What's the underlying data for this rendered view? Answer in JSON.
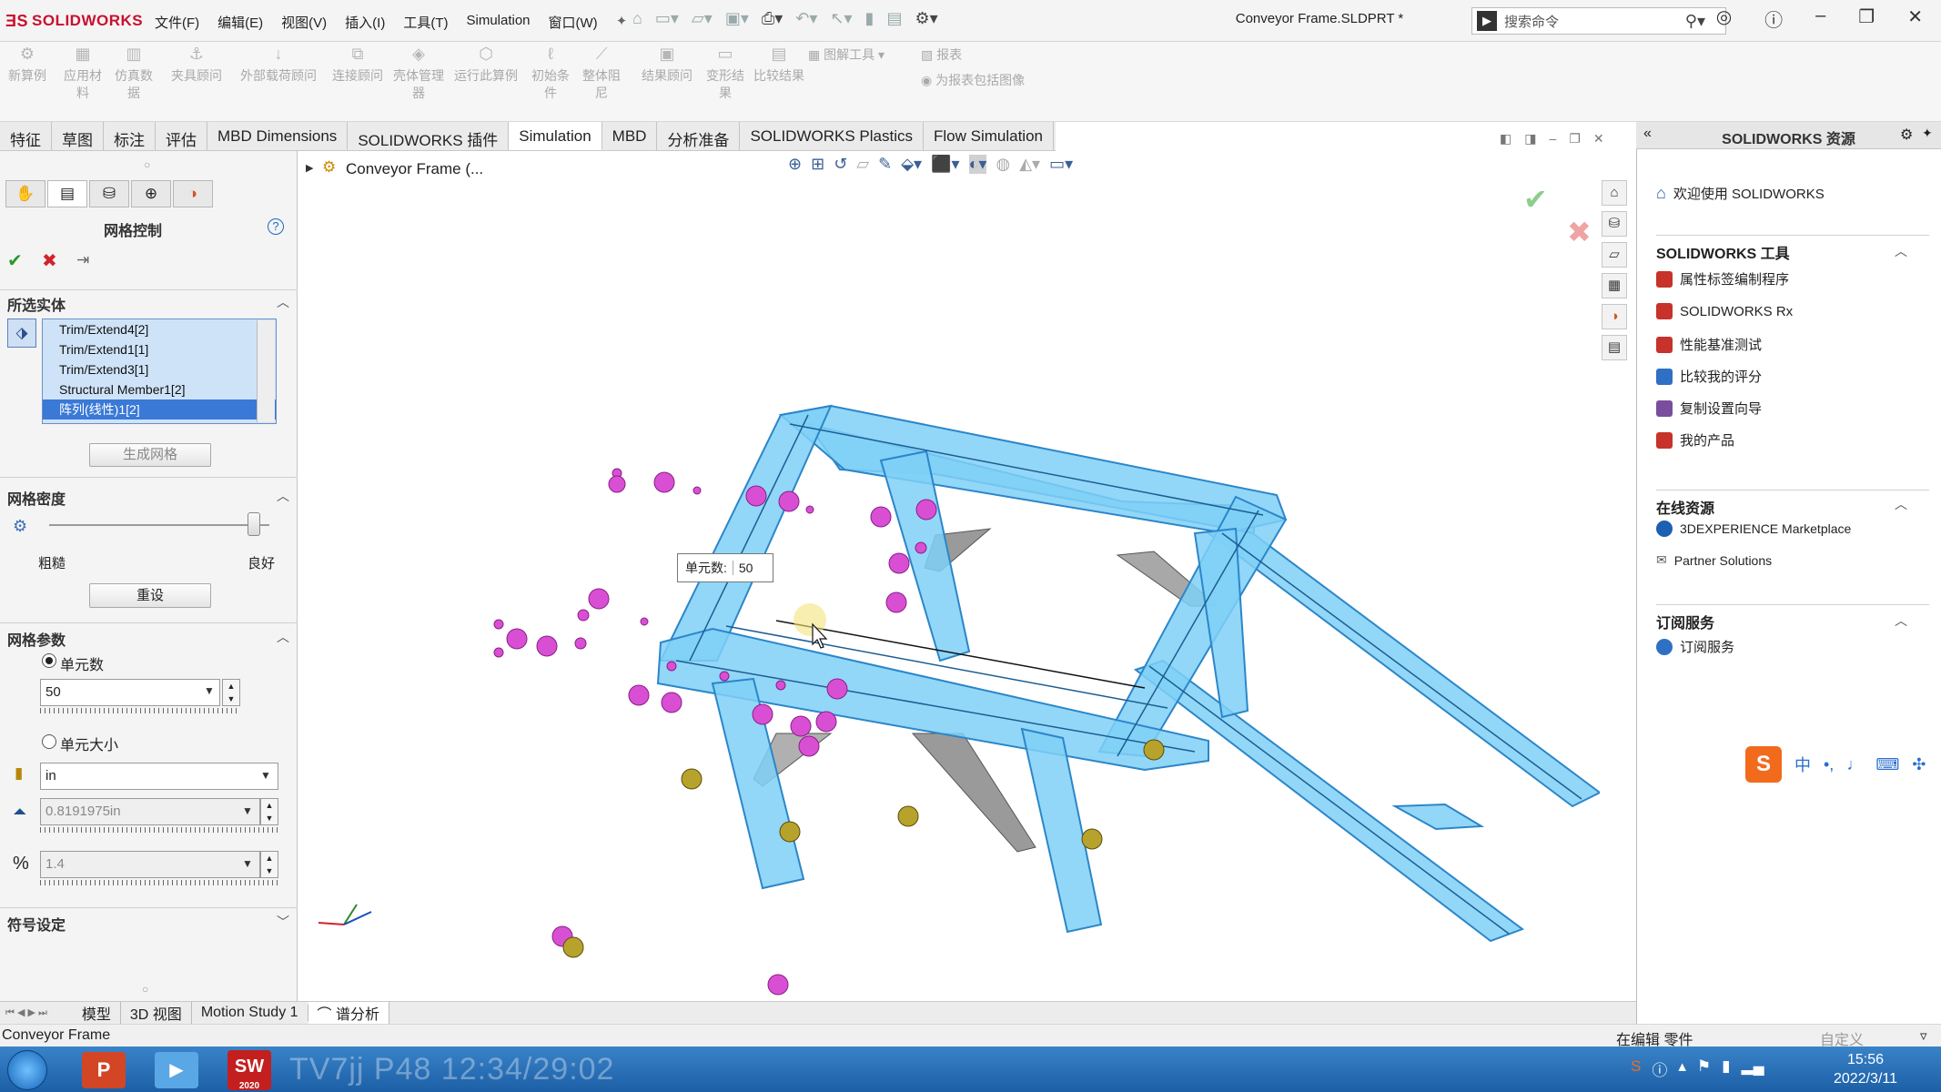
{
  "window": {
    "app_logo": "SOLIDWORKS",
    "doc_title": "Conveyor Frame.SLDPRT *",
    "search_placeholder": "搜索命令",
    "menus": [
      "文件(F)",
      "编辑(E)",
      "视图(V)",
      "插入(I)",
      "工具(T)",
      "Simulation",
      "窗口(W)"
    ]
  },
  "command_manager": {
    "buttons": [
      {
        "label": "新算例"
      },
      {
        "label": "应用材料"
      },
      {
        "label": "仿真数据"
      },
      {
        "label": "夹具顾问"
      },
      {
        "label": "外部载荷顾问"
      },
      {
        "label": "连接顾问"
      },
      {
        "label": "壳体管理器"
      },
      {
        "label": "运行此算例"
      },
      {
        "label": "初始条件"
      },
      {
        "label": "整体阻尼"
      },
      {
        "label": "结果顾问"
      },
      {
        "label": "变形结果"
      },
      {
        "label": "比较结果"
      }
    ],
    "side_items": [
      "图解工具",
      "报表",
      "为报表包括图像"
    ]
  },
  "tabs": [
    "特征",
    "草图",
    "标注",
    "评估",
    "MBD Dimensions",
    "SOLIDWORKS 插件",
    "Simulation",
    "MBD",
    "分析准备",
    "SOLIDWORKS Plastics",
    "Flow Simulation"
  ],
  "active_tab": "Simulation",
  "property_manager": {
    "title": "网格控制",
    "help": "?",
    "sections": {
      "selected_entities": "所选实体",
      "mesh_density": "网格密度",
      "mesh_params": "网格参数",
      "symbol": "符号设定"
    },
    "entities": [
      "Trim/Extend4[2]",
      "Trim/Extend1[1]",
      "Trim/Extend3[1]",
      "Structural Member1[2]",
      "阵列(线性)1[2]"
    ],
    "create_mesh_button": "生成网格",
    "coarse_label": "粗糙",
    "fine_label": "良好",
    "reset_button": "重设",
    "density_level": 0.93,
    "radio_element_count": "单元数",
    "element_count_value": "50",
    "radio_element_size": "单元大小",
    "unit_value": "in",
    "size_value": "0.8191975in",
    "ratio_value": "1.4"
  },
  "graphics": {
    "tree_label": "Conveyor Frame (...",
    "callout_label": "单元数:",
    "callout_value": "50",
    "colors": {
      "beam_fill": "#7fd0f7",
      "beam_stroke": "#2b86c9",
      "control_dot": "#d94fd4",
      "fixture_dot": "#b7a32b"
    }
  },
  "task_pane": {
    "title": "SOLIDWORKS 资源",
    "welcome": "欢迎使用 SOLIDWORKS",
    "tools_title": "SOLIDWORKS 工具",
    "tools": [
      "属性标签编制程序",
      "SOLIDWORKS Rx",
      "性能基准测试",
      "比较我的评分",
      "复制设置向导",
      "我的产品"
    ],
    "online_title": "在线资源",
    "online": [
      "3DEXPERIENCE Marketplace",
      "Partner Solutions"
    ],
    "subscription_title": "订阅服务",
    "subscription": [
      "订阅服务"
    ]
  },
  "bottom_tabs": [
    "模型",
    "3D 视图",
    "Motion Study 1",
    "谱分析"
  ],
  "status": {
    "left": "Conveyor Frame",
    "middle": "在编辑 零件",
    "right": "自定义"
  },
  "taskbar": {
    "time": "15:56",
    "date": "2022/3/11",
    "watermark": "TV7jj P48 12:34/29:02",
    "sw_badge": "2020"
  }
}
